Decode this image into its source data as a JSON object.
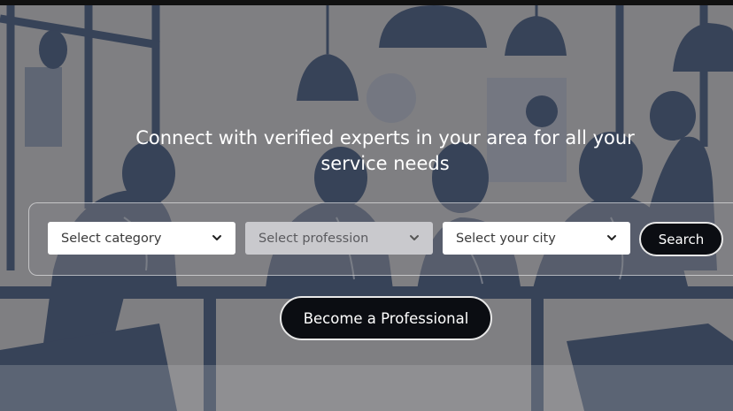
{
  "hero": {
    "tagline": "Connect with verified experts in your area for all your service needs",
    "background": "illustration-people-working-at-table"
  },
  "search": {
    "category_placeholder": "Select category",
    "profession_placeholder": "Select profession",
    "city_placeholder": "Select your city",
    "search_label": "Search"
  },
  "cta": {
    "become_professional_label": "Become a Professional"
  },
  "colors": {
    "navy_illustration": "#1d2e4d",
    "button_dark": "#0b0d12",
    "select_disabled": "#c9c9cd"
  }
}
